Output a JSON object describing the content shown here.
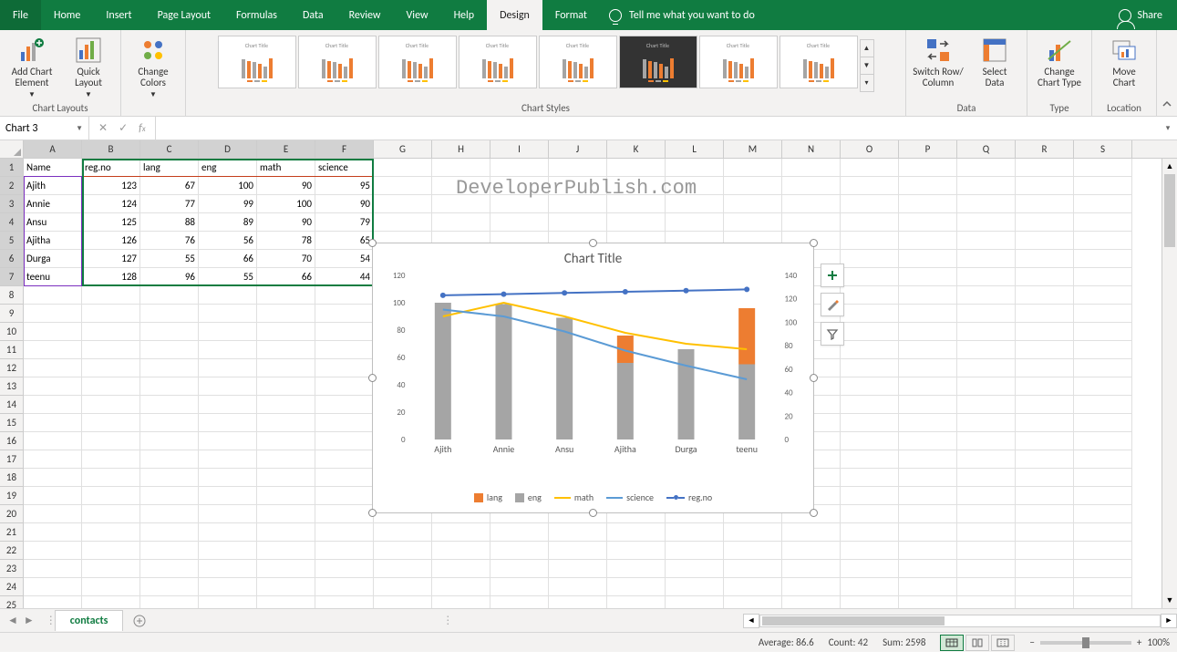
{
  "tabs": {
    "file": "File",
    "home": "Home",
    "insert": "Insert",
    "page_layout": "Page Layout",
    "formulas": "Formulas",
    "data": "Data",
    "review": "Review",
    "view": "View",
    "help": "Help",
    "design": "Design",
    "format": "Format",
    "tellme": "Tell me what you want to do",
    "share": "Share"
  },
  "ribbon": {
    "add_chart_element": "Add Chart\nElement",
    "quick_layout": "Quick\nLayout",
    "change_colors": "Change\nColors",
    "switch_row_col": "Switch Row/\nColumn",
    "select_data": "Select\nData",
    "change_chart_type": "Change\nChart Type",
    "move_chart": "Move\nChart",
    "group_chart_layouts": "Chart Layouts",
    "group_chart_styles": "Chart Styles",
    "group_data": "Data",
    "group_type": "Type",
    "group_location": "Location",
    "style_thumb_title": "Chart Title"
  },
  "namebox": "Chart 3",
  "columns": [
    "A",
    "B",
    "C",
    "D",
    "E",
    "F",
    "G",
    "H",
    "I",
    "J",
    "K",
    "L",
    "M",
    "N",
    "O",
    "P",
    "Q",
    "R",
    "S"
  ],
  "headers": [
    "Name",
    "reg.no",
    "lang",
    "eng",
    "math",
    "science"
  ],
  "data_rows": [
    {
      "n": "Ajith",
      "r": 123,
      "l": 67,
      "e": 100,
      "m": 90,
      "s": 95
    },
    {
      "n": "Annie",
      "r": 124,
      "l": 77,
      "e": 99,
      "m": 100,
      "s": 90
    },
    {
      "n": "Ansu",
      "r": 125,
      "l": 88,
      "e": 89,
      "m": 90,
      "s": 79
    },
    {
      "n": "Ajitha",
      "r": 126,
      "l": 76,
      "e": 56,
      "m": 78,
      "s": 65
    },
    {
      "n": "Durga",
      "r": 127,
      "l": 55,
      "e": 66,
      "m": 70,
      "s": 54
    },
    {
      "n": "teenu",
      "r": 128,
      "l": 96,
      "e": 55,
      "m": 66,
      "s": 44
    }
  ],
  "watermark": "DeveloperPublish.com",
  "chart": {
    "title": "Chart Title",
    "legend": {
      "lang": "lang",
      "eng": "eng",
      "math": "math",
      "science": "science",
      "regno": "reg.no"
    }
  },
  "chart_data": {
    "type": "bar",
    "title": "Chart Title",
    "categories": [
      "Ajith",
      "Annie",
      "Ansu",
      "Ajitha",
      "Durga",
      "teenu"
    ],
    "primary_axis": {
      "label": "",
      "range": [
        0,
        120
      ],
      "ticks": [
        0,
        20,
        40,
        60,
        80,
        100,
        120
      ]
    },
    "secondary_axis": {
      "label": "",
      "range": [
        0,
        140
      ],
      "ticks": [
        0,
        20,
        40,
        60,
        80,
        100,
        120,
        140
      ]
    },
    "series": [
      {
        "name": "lang",
        "type": "bar",
        "axis": "primary",
        "color": "#ED7D31",
        "values": [
          67,
          77,
          88,
          76,
          55,
          96
        ]
      },
      {
        "name": "eng",
        "type": "bar",
        "axis": "primary",
        "color": "#A5A5A5",
        "values": [
          100,
          99,
          89,
          56,
          66,
          55
        ]
      },
      {
        "name": "math",
        "type": "line",
        "axis": "primary",
        "color": "#FFC000",
        "values": [
          90,
          100,
          90,
          78,
          70,
          66
        ]
      },
      {
        "name": "science",
        "type": "line",
        "axis": "primary",
        "color": "#5B9BD5",
        "values": [
          95,
          90,
          79,
          65,
          54,
          44
        ]
      },
      {
        "name": "reg.no",
        "type": "line_marker",
        "axis": "secondary",
        "color": "#4472C4",
        "values": [
          123,
          124,
          125,
          126,
          127,
          128
        ]
      }
    ]
  },
  "sheet_tab": "contacts",
  "status": {
    "avg": "Average: 86.6",
    "count": "Count: 42",
    "sum": "Sum: 2598",
    "zoom": "100%"
  }
}
